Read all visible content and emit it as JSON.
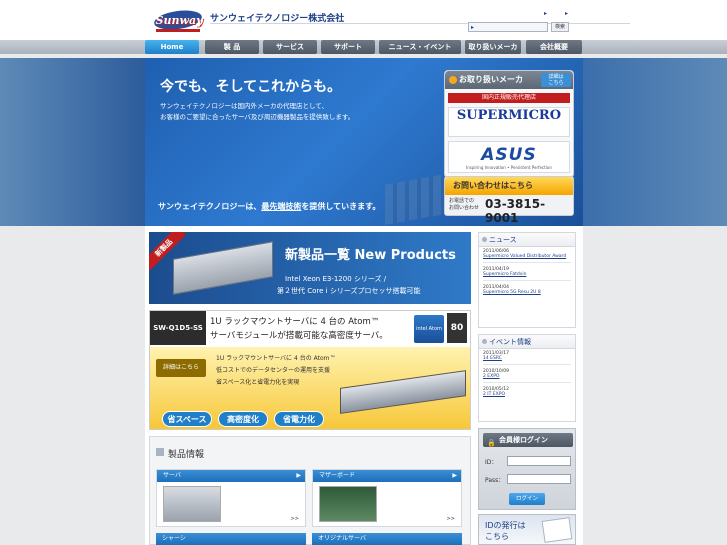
{
  "header": {
    "logo_text": "Sunway",
    "company_name": "サンウェイテクノロジー株式会社",
    "top_links": [
      "",
      ""
    ],
    "search_button": "検索"
  },
  "nav": [
    {
      "label": "Home",
      "active": true
    },
    {
      "label": "製 品"
    },
    {
      "label": "サービス"
    },
    {
      "label": "サポート"
    },
    {
      "label": "ニュース・イベント"
    },
    {
      "label": "取り扱いメーカ"
    },
    {
      "label": "会社概要"
    }
  ],
  "hero": {
    "title": "今でも、そしてこれからも。",
    "sub1": "サンウェイテクノロジーは国内外メーカの代理店として、",
    "sub2": "お客様のご要望に合ったサーバ及び周辺機器製品を提供致します。",
    "tag_prefix": "サンウェイテクノロジーは、",
    "tag_highlight": "最先端技術",
    "tag_suffix": "を提供していきます。"
  },
  "distributors": {
    "title": "お取り扱いメーカ",
    "detail_button_l1": "詳細は",
    "detail_button_l2": "こちら",
    "label": "国内正規販売代理店",
    "vendor1": "SUPERMICRO",
    "vendor2": "ASUS",
    "vendor2_slogan": "Inspiring Innovation • Persistent Perfection"
  },
  "contact": {
    "title": "お問い合わせはこちら",
    "phone_label_l1": "お電話での",
    "phone_label_l2": "お問い合わせ",
    "phone": "03-3815-9001"
  },
  "banner_new": {
    "ribbon": "新製品",
    "title": "新製品一覧 New Products",
    "line1": "Intel Xeon E3-1200 シリーズ /",
    "line2": "第２世代 Core i シリーズプロセッサ搭載可能"
  },
  "banner_atom": {
    "model": "SW-Q1D5-SS",
    "headline1": "1U ラックマウントサーバに 4 台の Atom™",
    "headline2": "サーバモジュールが搭載可能な高密度サーバ。",
    "chip": "intel Atom",
    "plus80": "80",
    "detail_button": "詳細はこちら",
    "bullets": [
      "1U ラックマウントサーバに 4 台の Atom™",
      "低コストでのデータセンターの運用を支援",
      "省スペース化と省電力化を実現"
    ],
    "badges": [
      "省スペース",
      "高密度化",
      "省電力化"
    ]
  },
  "products": {
    "title": "製品情報",
    "categories": [
      {
        "label": "サーバ",
        "more": ">>"
      },
      {
        "label": "マザーボード",
        "more": ">>"
      }
    ],
    "categories2": [
      "シャーシ",
      "オリジナルサーバ"
    ]
  },
  "news": {
    "title": "ニュース",
    "items": [
      {
        "date": "2011/06/06",
        "text": "Supermicro Valued Distributor Award"
      },
      {
        "date": "2011/04/19",
        "text": "Supermicro Fatdvin"
      },
      {
        "date": "2011/04/04",
        "text": "Supermicro 5G Resu         2U 8"
      }
    ]
  },
  "events": {
    "title": "イベント情報",
    "items": [
      {
        "date": "2011/03/17",
        "text": "14       ESRC"
      },
      {
        "date": "2010/10/09",
        "text": "2         EXPO"
      },
      {
        "date": "2010/05/12",
        "text": "2      IT EXPO"
      }
    ]
  },
  "login": {
    "title": "会員様ログイン",
    "id_label": "ID：",
    "pass_label": "Pass：",
    "button": "ログイン"
  },
  "id_issue": {
    "line1": "IDの発行は",
    "line2": "こちら"
  }
}
